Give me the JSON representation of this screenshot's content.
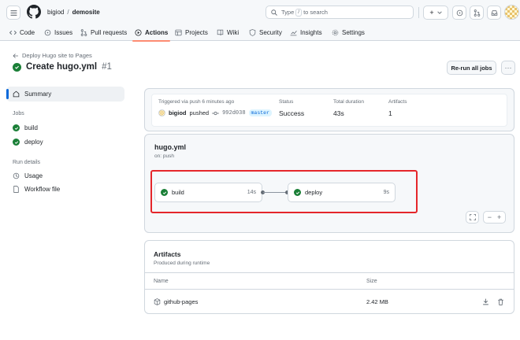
{
  "header": {
    "owner": "bigiod",
    "separator": "/",
    "repo": "demosite",
    "search_prefix": "Type",
    "search_key": "/",
    "search_suffix": "to search",
    "plus_label": "+",
    "icons": [
      "menu-icon",
      "github-logo-icon",
      "search-icon",
      "plus-icon",
      "chevron-down-icon",
      "copilot-icon",
      "pull-request-icon",
      "inbox-icon",
      "avatar"
    ]
  },
  "tabs": [
    {
      "label": "Code",
      "icon": "code-icon"
    },
    {
      "label": "Issues",
      "icon": "issue-icon"
    },
    {
      "label": "Pull requests",
      "icon": "pull-request-icon"
    },
    {
      "label": "Actions",
      "icon": "play-icon",
      "active": true
    },
    {
      "label": "Projects",
      "icon": "table-icon"
    },
    {
      "label": "Wiki",
      "icon": "book-icon"
    },
    {
      "label": "Security",
      "icon": "shield-icon"
    },
    {
      "label": "Insights",
      "icon": "graph-icon"
    },
    {
      "label": "Settings",
      "icon": "gear-icon"
    }
  ],
  "run": {
    "back_label": "Deploy Hugo site to Pages",
    "title": "Create hugo.yml",
    "number": "#1",
    "rerun_label": "Re-run all jobs",
    "more_label": "···"
  },
  "sidebar": {
    "summary_label": "Summary",
    "jobs_heading": "Jobs",
    "jobs": [
      "build",
      "deploy"
    ],
    "run_details_heading": "Run details",
    "details": [
      {
        "label": "Usage",
        "icon": "clock-icon"
      },
      {
        "label": "Workflow file",
        "icon": "file-icon"
      }
    ]
  },
  "summary": {
    "trigger_label": "Triggered via push 6 minutes ago",
    "actor": "bigiod",
    "action": "pushed",
    "commit": "992d038",
    "branch": "master",
    "status_label": "Status",
    "status_value": "Success",
    "duration_label": "Total duration",
    "duration_value": "43s",
    "artifacts_label": "Artifacts",
    "artifacts_value": "1"
  },
  "workflow": {
    "name": "hugo.yml",
    "trigger": "on: push",
    "jobs": [
      {
        "name": "build",
        "duration": "14s"
      },
      {
        "name": "deploy",
        "duration": "9s"
      }
    ],
    "zoom_minus": "−",
    "zoom_plus": "+"
  },
  "artifacts": {
    "title": "Artifacts",
    "subtitle": "Produced during runtime",
    "col_name": "Name",
    "col_size": "Size",
    "rows": [
      {
        "name": "github-pages",
        "size": "2.42 MB"
      }
    ]
  },
  "colors": {
    "success": "#1a7f37",
    "accent_tab": "#fd8c73",
    "highlight": "#e5262a",
    "link": "#0969da"
  }
}
